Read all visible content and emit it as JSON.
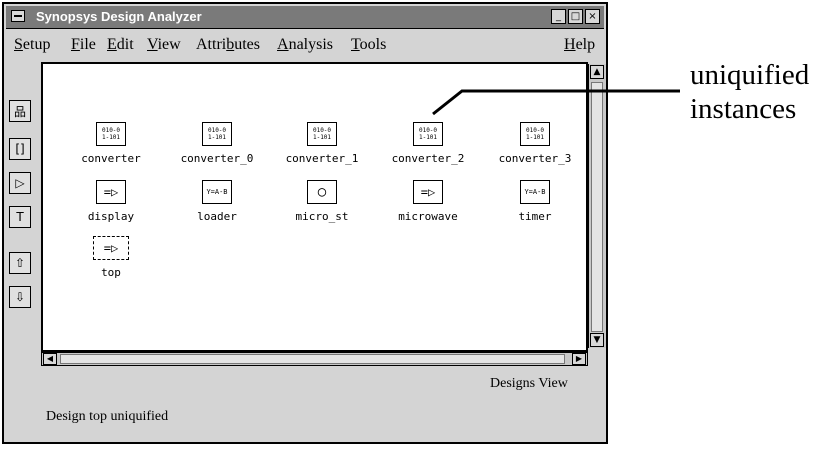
{
  "window": {
    "title": "Synopsys Design Analyzer",
    "buttons": [
      "_",
      "□",
      "×"
    ]
  },
  "menubar": {
    "items": [
      {
        "prefix": "",
        "accel": "S",
        "rest": "etup"
      },
      {
        "prefix": "",
        "accel": "F",
        "rest": "ile"
      },
      {
        "prefix": "",
        "accel": "E",
        "rest": "dit"
      },
      {
        "prefix": "",
        "accel": "V",
        "rest": "iew"
      },
      {
        "prefix": "Attri",
        "accel": "b",
        "rest": "utes"
      },
      {
        "prefix": "",
        "accel": "A",
        "rest": "nalysis"
      },
      {
        "prefix": "",
        "accel": "T",
        "rest": "ools"
      },
      {
        "prefix": "",
        "accel": "H",
        "rest": "elp"
      }
    ]
  },
  "toolbar": {
    "tools": [
      {
        "icon": "hierarchy-icon",
        "glyph": "品"
      },
      {
        "icon": "symbol-icon",
        "glyph": "[]"
      },
      {
        "icon": "gate-icon",
        "glyph": "▷"
      },
      {
        "icon": "schematic-icon",
        "glyph": "T"
      },
      {
        "icon": "up-arrow-icon",
        "glyph": "⇧"
      },
      {
        "icon": "down-arrow-icon",
        "glyph": "⇩"
      }
    ]
  },
  "designs": [
    {
      "name": "converter",
      "symbol": "010-0\n1-101"
    },
    {
      "name": "converter_0",
      "symbol": "010-0\n1-101"
    },
    {
      "name": "converter_1",
      "symbol": "010-0\n1-101"
    },
    {
      "name": "converter_2",
      "symbol": "010-0\n1-101"
    },
    {
      "name": "converter_3",
      "symbol": "010-0\n1-101"
    },
    {
      "name": "display",
      "symbol": "=▷"
    },
    {
      "name": "loader",
      "symbol": "Y=A-B"
    },
    {
      "name": "micro_st",
      "symbol": "○"
    },
    {
      "name": "microwave",
      "symbol": "=▷"
    },
    {
      "name": "timer",
      "symbol": "Y=A-B"
    },
    {
      "name": "top",
      "symbol": "=▷"
    }
  ],
  "view_label": "Designs View",
  "status": "Design top uniquified",
  "annotation": {
    "line1": "uniquified",
    "line2": "instances"
  }
}
